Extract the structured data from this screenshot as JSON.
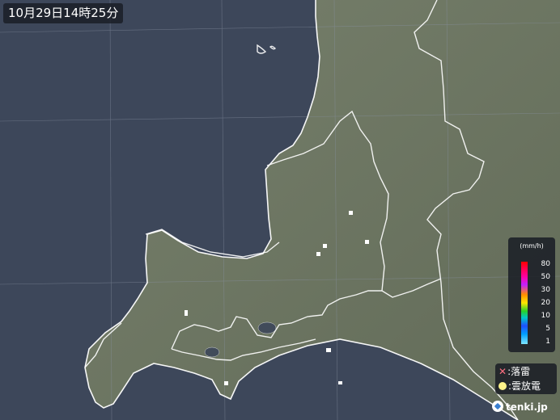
{
  "timestamp": "10月29日14時25分",
  "legend": {
    "unit": "(mm/h)",
    "levels": [
      "80",
      "50",
      "30",
      "20",
      "10",
      "5",
      "1"
    ]
  },
  "symbols": {
    "lightning_label": "落雷",
    "cloud_discharge_label": "雲放電",
    "lightning_mark": "✕"
  },
  "brand": "tenki.jp",
  "colors": {
    "sea": "#3d475a",
    "land": "#6c7462",
    "boundary": "#ffffff",
    "rain_weak": "#ffffff"
  }
}
